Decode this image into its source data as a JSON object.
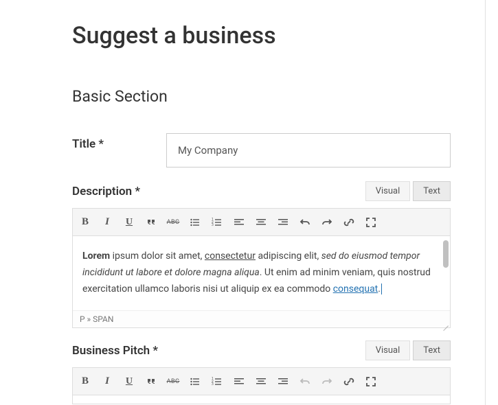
{
  "page": {
    "title": "Suggest a business",
    "section_title": "Basic Section"
  },
  "fields": {
    "title": {
      "label": "Title *",
      "value": "My Company"
    },
    "description": {
      "label": "Description *"
    },
    "pitch": {
      "label": "Business Pitch *"
    }
  },
  "editor": {
    "tabs": {
      "visual": "Visual",
      "text": "Text"
    },
    "toolbar": {
      "bold": "B",
      "italic": "I",
      "underline": "U",
      "strike": "ABC"
    },
    "content": {
      "lead": "Lorem",
      "p1": " ipsum dolor sit amet, ",
      "u1": "consectetur",
      "p2": " adipiscing elit, ",
      "it1": "sed do eiusmod tempor incididunt ut labore et dolore magna aliqua",
      "p3": ". Ut enim ad minim veniam, quis nostrud exercitation ullamco laboris nisi ut aliquip ex ea commodo ",
      "link1": "consequat",
      "tail": "."
    },
    "status": "P » SPAN"
  }
}
